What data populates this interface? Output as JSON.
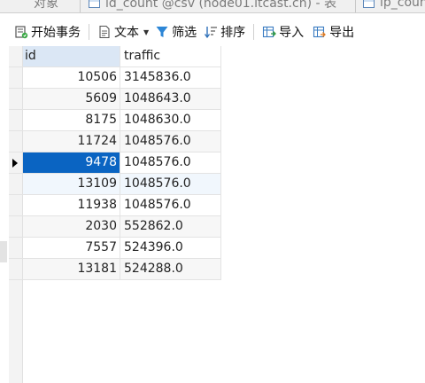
{
  "tabs": [
    {
      "label": "对象",
      "icon": "none"
    },
    {
      "label": "id_count @csv (node01.itcast.cn) - 表",
      "icon": "table-icon"
    },
    {
      "label": "ip_coun",
      "icon": "table-icon"
    }
  ],
  "toolbar": {
    "begin_transaction": "开始事务",
    "text": "文本",
    "filter": "筛选",
    "sort": "排序",
    "import": "导入",
    "export": "导出"
  },
  "table": {
    "columns": [
      "id",
      "traffic"
    ],
    "rows": [
      {
        "id": "10506",
        "traffic": "3145836.0"
      },
      {
        "id": "5609",
        "traffic": "1048643.0"
      },
      {
        "id": "8175",
        "traffic": "1048630.0"
      },
      {
        "id": "11724",
        "traffic": "1048576.0"
      },
      {
        "id": "9478",
        "traffic": "1048576.0"
      },
      {
        "id": "13109",
        "traffic": "1048576.0"
      },
      {
        "id": "11938",
        "traffic": "1048576.0"
      },
      {
        "id": "2030",
        "traffic": "552862.0"
      },
      {
        "id": "7557",
        "traffic": "524396.0"
      },
      {
        "id": "13181",
        "traffic": "524288.0"
      }
    ],
    "selected_row": 4
  },
  "colors": {
    "selection": "#0a64c2",
    "header_highlight": "#dbe7f5"
  }
}
